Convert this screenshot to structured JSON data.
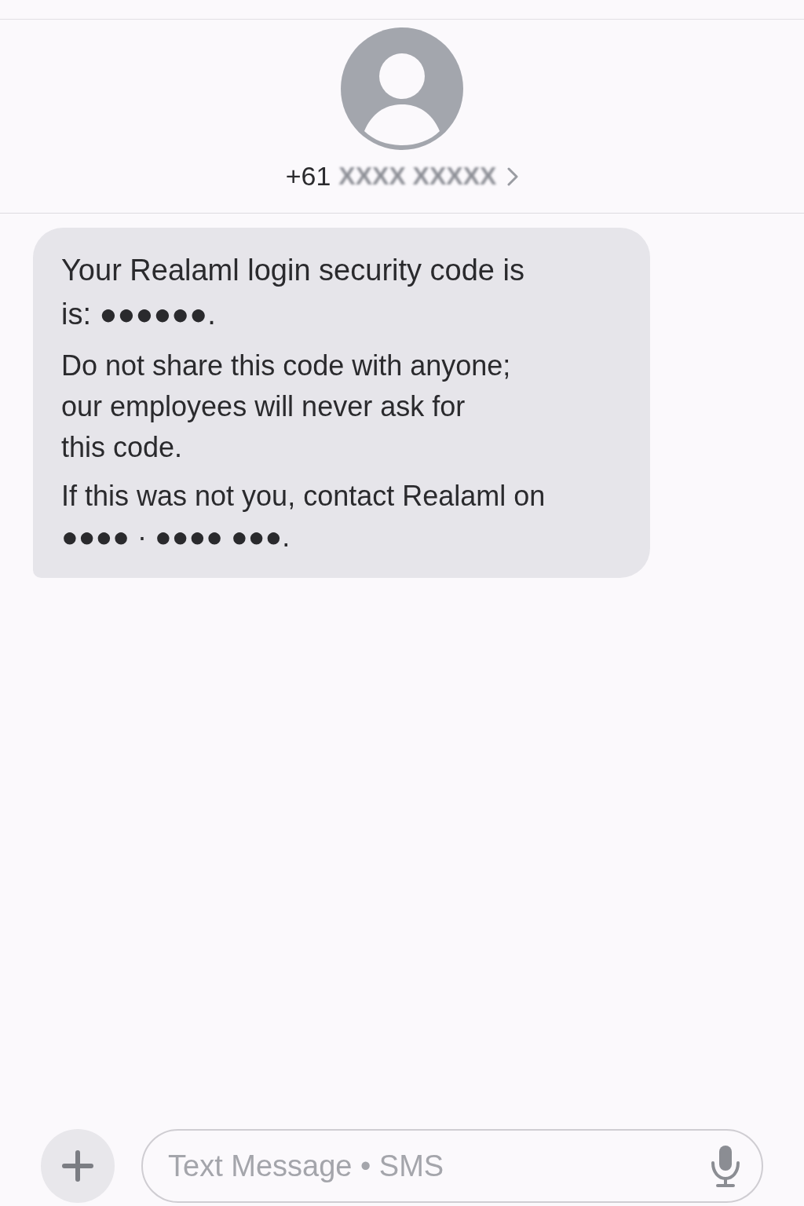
{
  "contact": {
    "phone": "+61",
    "phone_redacted": "XXXX XXXXX"
  },
  "messages": [
    {
      "kind": "incoming",
      "paragraphs": [
        "Your Realaml login security code is\nis: ●●●●●●.",
        "Do not share this code with anyone;\nour employees will never ask for\nthis code.",
        "If this was not you, contact Realaml on\n●●●● · ●●●● ●●●."
      ]
    }
  ],
  "composer": {
    "placeholder": "Text Message • SMS"
  }
}
